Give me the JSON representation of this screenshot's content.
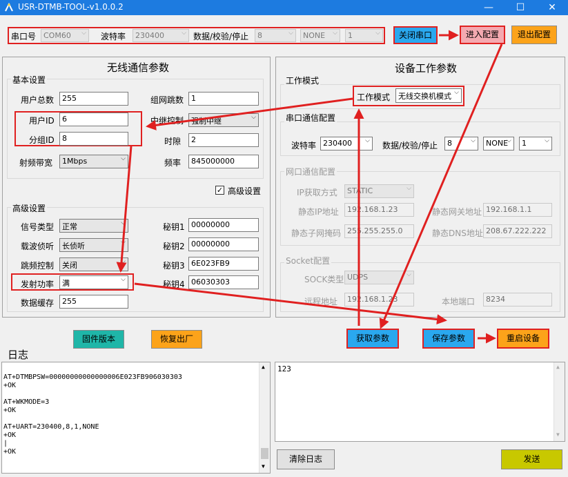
{
  "window": {
    "title": "USR-DTMB-TOOL-v1.0.0.2",
    "minimize": "—",
    "maximize": "☐",
    "close": "✕"
  },
  "serial": {
    "port_label": "串口号",
    "port_value": "COM60",
    "baud_label": "波特率",
    "baud_value": "230400",
    "format_label": "数据/校验/停止",
    "data_value": "8",
    "parity_value": "NONE",
    "stop_value": "1",
    "close_button": "关闭串口",
    "enter_config": "进入配置",
    "exit_config": "退出配置"
  },
  "wireless": {
    "title": "无线通信参数",
    "basic": {
      "legend": "基本设置",
      "total_users_label": "用户总数",
      "total_users": "255",
      "hop_label": "组网跳数",
      "hop": "1",
      "user_id_label": "用户ID",
      "user_id": "6",
      "relay_label": "中继控制",
      "relay": "强制中继",
      "group_id_label": "分组ID",
      "group_id": "8",
      "slot_label": "时隙",
      "slot": "2",
      "bandwidth_label": "射频带宽",
      "bandwidth": "1Mbps",
      "freq_label": "频率",
      "freq": "845000000",
      "advanced_checkbox": "高级设置"
    },
    "advanced": {
      "legend": "高级设置",
      "signal_label": "信号类型",
      "signal": "正常",
      "key1_label": "秘钥1",
      "key1": "00000000",
      "carrier_label": "载波侦听",
      "carrier": "长侦听",
      "key2_label": "秘钥2",
      "key2": "00000000",
      "hopctl_label": "跳频控制",
      "hopctl": "关闭",
      "key3_label": "秘钥3",
      "key3": "6E023FB9",
      "power_label": "发射功率",
      "power": "满",
      "key4_label": "秘钥4",
      "key4": "06030303",
      "buffer_label": "数据缓存",
      "buffer": "255"
    },
    "firmware_button": "固件版本",
    "factory_button": "恢复出厂"
  },
  "device": {
    "title": "设备工作参数",
    "mode_legend": "工作模式",
    "mode_label": "工作模式",
    "mode_value": "无线交换机模式",
    "uart_legend": "串口通信配置",
    "uart_baud_label": "波特率",
    "uart_baud": "230400",
    "uart_format_label": "数据/校验/停止",
    "uart_data": "8",
    "uart_parity": "NONE",
    "uart_stop": "1",
    "net_legend": "网口通信配置",
    "ip_mode_label": "IP获取方式",
    "ip_mode": "STATIC",
    "static_ip_label": "静态IP地址",
    "static_ip": "192.168.1.23",
    "gateway_label": "静态网关地址",
    "gateway": "192.168.1.1",
    "mask_label": "静态子网掩码",
    "mask": "255.255.255.0",
    "dns_label": "静态DNS地址",
    "dns": "208.67.222.222",
    "socket_legend": "Socket配置",
    "sock_type_label": "SOCK类型",
    "sock_type": "UDPS",
    "remote_label": "远程地址",
    "remote": "192.168.1.23",
    "local_port_label": "本地端口",
    "local_port": "8234",
    "get_button": "获取参数",
    "save_button": "保存参数",
    "restart_button": "重启设备"
  },
  "log": {
    "title": "日志",
    "lines": [
      "AT+DTMBPSW=00000000000000006E023FB906030303",
      "+OK",
      "",
      "AT+WKMODE=3",
      "+OK",
      "",
      "AT+UART=230400,8,1,NONE",
      "+OK",
      "|",
      "+OK"
    ],
    "clear_button": "清除日志",
    "send_text": "123",
    "send_button": "发送"
  },
  "colors": {
    "titlebar": "#1d7be0",
    "blue_button": "#2aa8ef",
    "orange_button": "#fca31a",
    "teal_button": "#1fb6a8",
    "pink_button": "#f4a9b0",
    "olive_button": "#c8c800",
    "red_annotation": "#e02020"
  }
}
